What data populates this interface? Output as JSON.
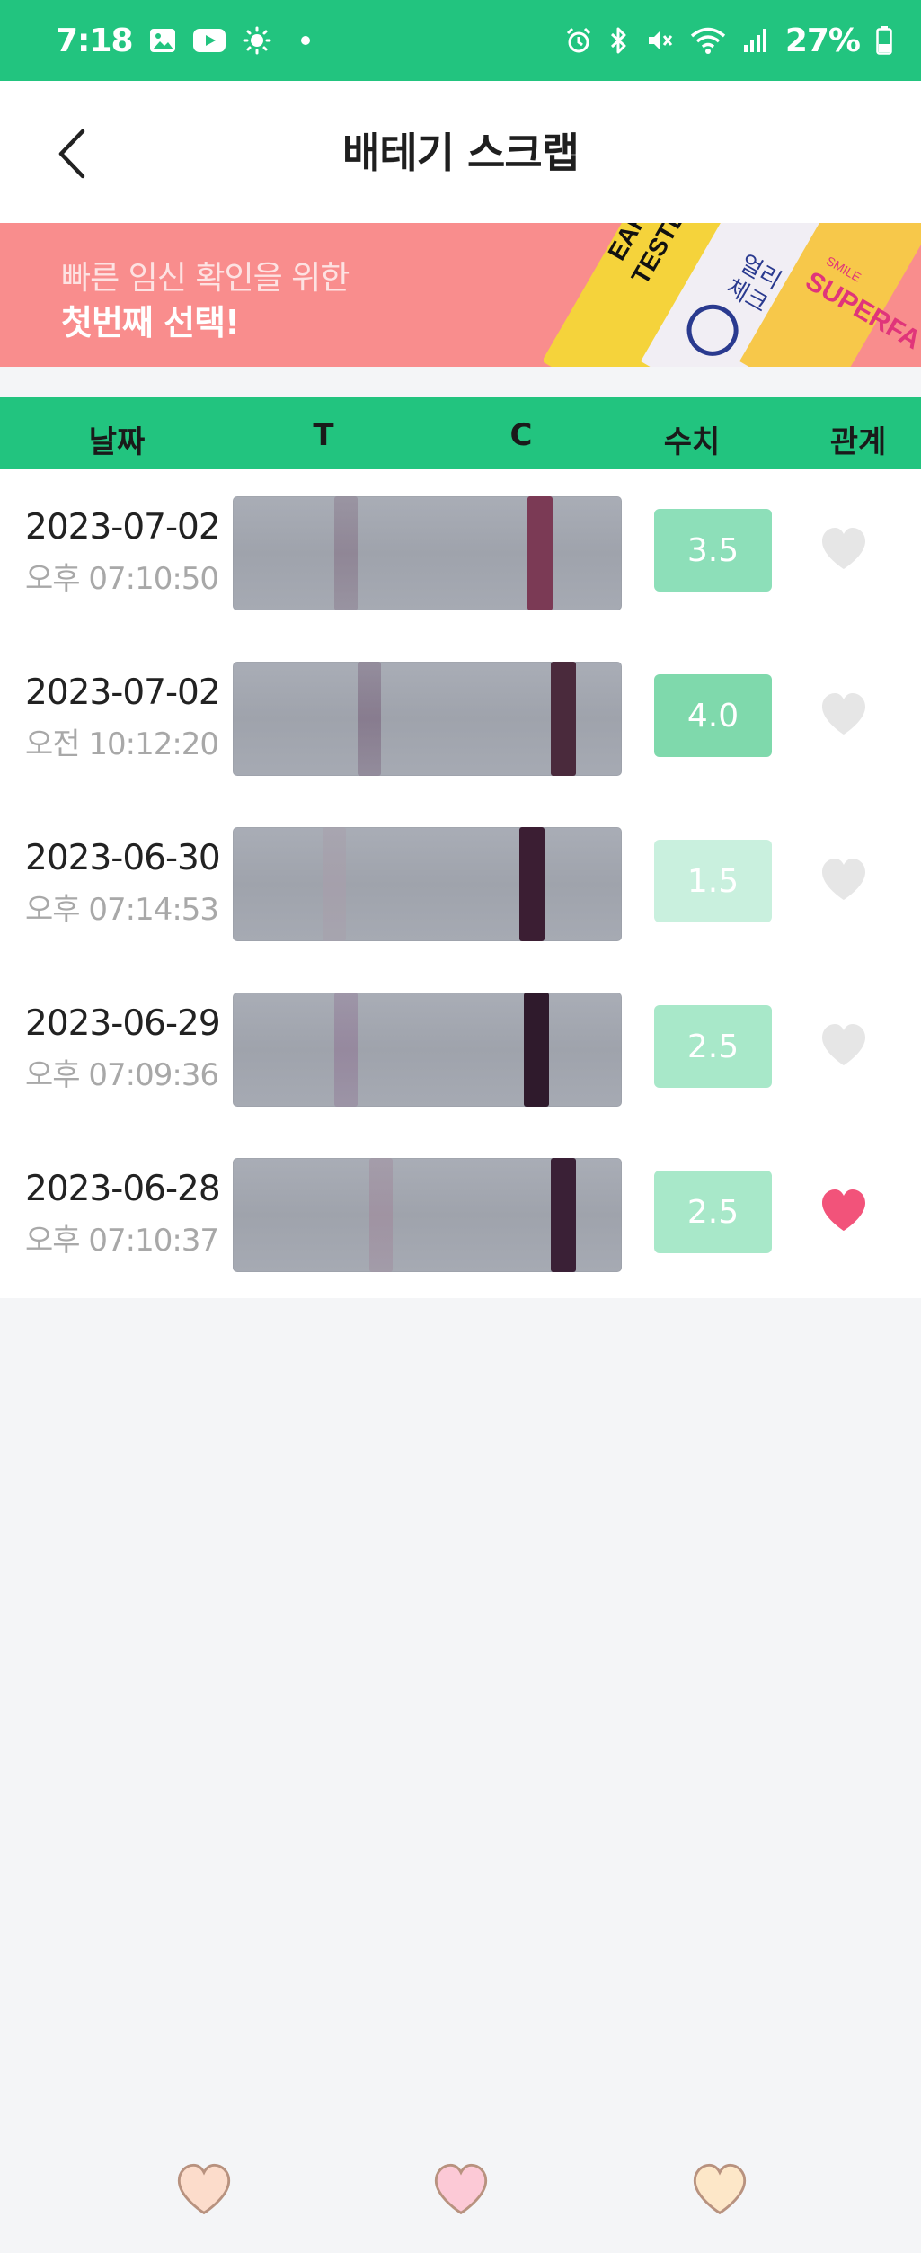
{
  "status_bar": {
    "time": "7:18",
    "battery": "27%",
    "left_icons": [
      "image-icon",
      "youtube-icon",
      "brightness-icon",
      "dot-icon"
    ],
    "right_icons": [
      "alarm-icon",
      "bluetooth-icon",
      "mute-icon",
      "wifi-icon",
      "signal-icon",
      "battery-icon"
    ]
  },
  "header": {
    "title": "배테기 스크랩",
    "back_icon": "chevron-left-icon"
  },
  "banner": {
    "line1": "빠른 임신 확인을 위한",
    "line2": "첫번째 선택!",
    "products": [
      {
        "name": "EARLY TESTER",
        "color": "#f5d33b"
      },
      {
        "name": "얼리 체크",
        "color": "#f1eef4"
      },
      {
        "name": "SMILE SUPERFA",
        "color": "#f7c84a"
      }
    ]
  },
  "table": {
    "headers": {
      "date": "날짜",
      "t": "T",
      "c": "C",
      "value": "수치",
      "relation": "관계"
    },
    "rows": [
      {
        "date": "2023-07-02",
        "time": "오후 07:10:50",
        "value": "3.5",
        "liked": false,
        "badge_color": "#8ddfb9",
        "t_pos": 0.29,
        "c_pos": 0.79,
        "t_color": "#8b7d8f",
        "c_color": "#7b3a55"
      },
      {
        "date": "2023-07-02",
        "time": "오전 10:12:20",
        "value": "4.0",
        "liked": false,
        "badge_color": "#7fd9ac",
        "t_pos": 0.35,
        "c_pos": 0.85,
        "t_color": "#806f85",
        "c_color": "#4a2a3c"
      },
      {
        "date": "2023-06-30",
        "time": "오후 07:14:53",
        "value": "1.5",
        "liked": false,
        "badge_color": "#c9f0de",
        "t_pos": 0.26,
        "c_pos": 0.77,
        "t_color": "#a79fab",
        "c_color": "#3b1e33"
      },
      {
        "date": "2023-06-29",
        "time": "오후 07:09:36",
        "value": "2.5",
        "liked": false,
        "badge_color": "#a8e8c9",
        "t_pos": 0.29,
        "c_pos": 0.78,
        "t_color": "#93809a",
        "c_color": "#2f1a2c"
      },
      {
        "date": "2023-06-28",
        "time": "오후 07:10:37",
        "value": "2.5",
        "liked": true,
        "badge_color": "#a8e8c9",
        "t_pos": 0.38,
        "c_pos": 0.85,
        "t_color": "#a08e9f",
        "c_color": "#3a2036"
      }
    ]
  },
  "bottom_nav": [
    {
      "icon": "heart-peach-icon",
      "color": "#fcdccb"
    },
    {
      "icon": "heart-pink-icon",
      "color": "#fcc9d6"
    },
    {
      "icon": "heart-cream-icon",
      "color": "#fde7c8"
    }
  ],
  "colors": {
    "accent": "#22c47f",
    "heart_liked": "#f2537a",
    "heart_unliked": "#e6e6e6"
  }
}
